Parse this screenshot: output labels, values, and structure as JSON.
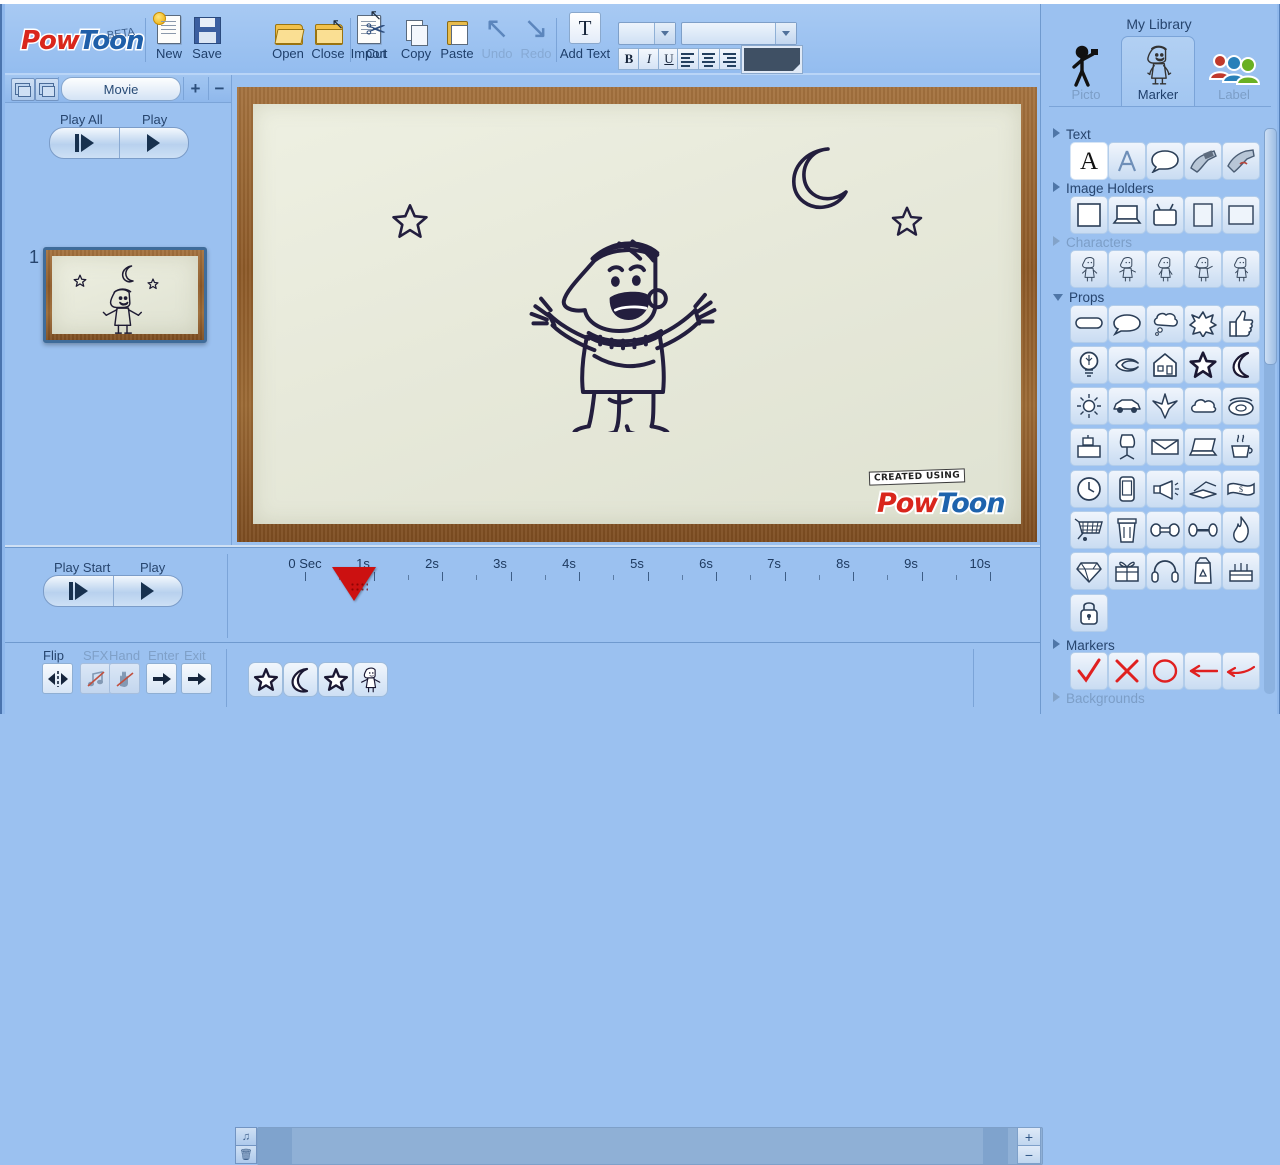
{
  "app": {
    "brand": "PowToon",
    "brand_part_a": "Pow",
    "brand_part_b": "Toon",
    "badge": "BETA",
    "accent_red": "#d9261c",
    "accent_blue": "#1f5fa9",
    "panel_bg": "#9bc1f0"
  },
  "toolbar": {
    "items": [
      {
        "label": "New",
        "icon": "new-document-icon",
        "enabled": true
      },
      {
        "label": "Save",
        "icon": "floppy-disk-icon",
        "enabled": true
      },
      {
        "label": "Open",
        "icon": "open-folder-icon",
        "enabled": true
      },
      {
        "label": "Close",
        "icon": "close-folder-icon",
        "enabled": true
      },
      {
        "label": "Import",
        "icon": "import-document-icon",
        "enabled": true
      },
      {
        "label": "Cut",
        "icon": "scissors-icon",
        "enabled": true
      },
      {
        "label": "Copy",
        "icon": "copy-pages-icon",
        "enabled": true
      },
      {
        "label": "Paste",
        "icon": "clipboard-paste-icon",
        "enabled": true
      },
      {
        "label": "Undo",
        "icon": "undo-arrow-icon",
        "enabled": false
      },
      {
        "label": "Redo",
        "icon": "redo-arrow-icon",
        "enabled": false
      },
      {
        "label": "Add Text",
        "icon": "text-T-icon",
        "enabled": true
      }
    ],
    "font_size_value": "",
    "font_family_value": "",
    "bold_label": "B",
    "italic_label": "I",
    "underline_label": "U",
    "align_left": "align-left-icon",
    "align_center": "align-center-icon",
    "align_right": "align-right-icon",
    "color_swatch": "#3f5064"
  },
  "scenes": {
    "tab_label": "Movie",
    "add_label": "+",
    "remove_label": "−",
    "play_all_label": "Play All",
    "play_label": "Play",
    "slide_number": "1"
  },
  "canvas": {
    "watermark_tag": "CREATED USING",
    "watermark_brand_a": "Pow",
    "watermark_brand_b": "Toon",
    "objects": [
      "star-left",
      "moon",
      "star-right",
      "character-cheering"
    ]
  },
  "timeline": {
    "play_start_label": "Play Start",
    "play_label": "Play",
    "ticks": [
      "0 Sec",
      "1s",
      "2s",
      "3s",
      "4s",
      "5s",
      "6s",
      "7s",
      "8s",
      "9s",
      "10s"
    ],
    "playhead_time": "1s",
    "zoom_in_label": "+",
    "zoom_out_label": "−",
    "audio_button": "music-note-icon",
    "delete_button": "trash-icon"
  },
  "bottom_bar": {
    "flip_label": "Flip",
    "sfx_label": "SFX",
    "hand_label": "Hand",
    "enter_label": "Enter",
    "exit_label": "Exit",
    "flip_enabled": true,
    "sfx_enabled": false,
    "hand_enabled": false,
    "elements": [
      {
        "name": "star-element",
        "icon": "star-icon"
      },
      {
        "name": "moon-element",
        "icon": "moon-icon"
      },
      {
        "name": "star-element-2",
        "icon": "star-icon"
      },
      {
        "name": "character-element",
        "icon": "character-icon"
      }
    ]
  },
  "library": {
    "title": "My Library",
    "tabs": [
      {
        "label": "Picto",
        "icon": "picto-stickman-icon",
        "active": false
      },
      {
        "label": "Marker",
        "icon": "marker-character-icon",
        "active": true
      },
      {
        "label": "Label",
        "icon": "label-people-icon",
        "active": false
      }
    ],
    "sections": [
      {
        "label": "Text",
        "open": false,
        "dim": false
      },
      {
        "label": "Image Holders",
        "open": false,
        "dim": false
      },
      {
        "label": "Characters",
        "open": false,
        "dim": true
      },
      {
        "label": "Props",
        "open": true,
        "dim": false
      },
      {
        "label": "Markers",
        "open": false,
        "dim": false
      },
      {
        "label": "Backgrounds",
        "open": false,
        "dim": true
      }
    ],
    "text_items": [
      "letter-A-icon",
      "outline-A-icon",
      "speech-bubble-icon",
      "hand-marker-icon",
      "hand-erase-icon"
    ],
    "image_holder_items": [
      "blank-frame-icon",
      "laptop-icon",
      "tv-icon",
      "portrait-frame-icon",
      "landscape-frame-icon"
    ],
    "character_items": [
      "character-1-icon",
      "character-2-icon",
      "character-3-icon",
      "character-4-icon",
      "character-5-icon"
    ],
    "prop_items": [
      "rectangle-bubble-icon",
      "speech-bubble-icon",
      "thought-cloud-icon",
      "burst-icon",
      "thumbs-up-icon",
      "lightbulb-icon",
      "fish-icon",
      "house-icon",
      "star-icon",
      "moon-icon",
      "sun-icon",
      "car-icon",
      "airplane-icon",
      "cloud-icon",
      "telephone-icon",
      "cash-register-icon",
      "office-chair-icon",
      "envelope-icon",
      "laptop-icon",
      "coffee-cup-icon",
      "clock-icon",
      "smartphone-icon",
      "megaphone-icon",
      "open-book-icon",
      "dollar-bill-icon",
      "shopping-cart-icon",
      "trash-bin-icon",
      "dumbbell-icon",
      "barbell-icon",
      "flame-icon",
      "diamond-icon",
      "gift-box-icon",
      "headphones-icon",
      "recycle-bag-icon",
      "cake-icon",
      "padlock-icon"
    ],
    "marker_items": [
      "checkmark-icon",
      "x-cross-icon",
      "circle-icon",
      "arrow-left-icon",
      "swoosh-icon"
    ]
  }
}
